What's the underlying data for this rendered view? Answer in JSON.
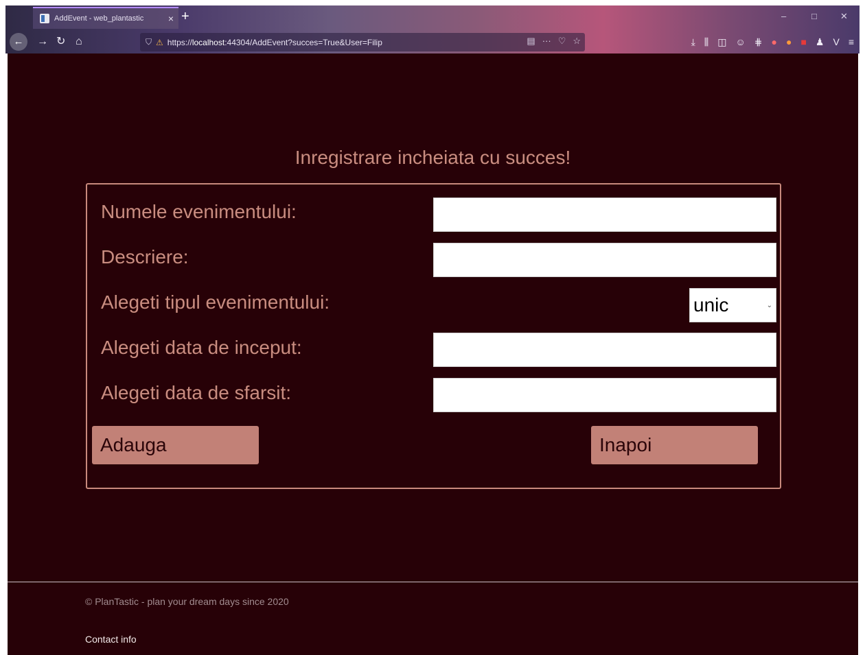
{
  "browser": {
    "tab_title": "AddEvent - web_plantastic",
    "tab_close": "×",
    "new_tab": "+",
    "window_controls": {
      "minimize": "–",
      "maximize": "□",
      "close": "✕"
    },
    "url": {
      "prefix": "https://",
      "host": "localhost",
      "rest": ":44304/AddEvent?succes=True&User=Filip"
    }
  },
  "page": {
    "success_message": "Inregistrare incheiata cu succes!",
    "form": {
      "event_name_label": "Numele evenimentului:",
      "event_name_value": "",
      "description_label": "Descriere:",
      "description_value": "",
      "event_type_label": "Alegeti tipul evenimentului:",
      "event_type_selected": "unic",
      "start_date_label": "Alegeti data de inceput:",
      "start_date_value": "",
      "end_date_label": "Alegeti data de sfarsit:",
      "end_date_value": "",
      "add_button": "Adauga",
      "back_button": "Inapoi"
    },
    "footer": {
      "copyright": "© PlanTastic - plan your dream days since 2020",
      "contact": "Contact info"
    }
  },
  "colors": {
    "page_background": "#270107",
    "label_text": "#c98d80",
    "button_background": "#c28177",
    "form_border": "#c88a7d"
  }
}
